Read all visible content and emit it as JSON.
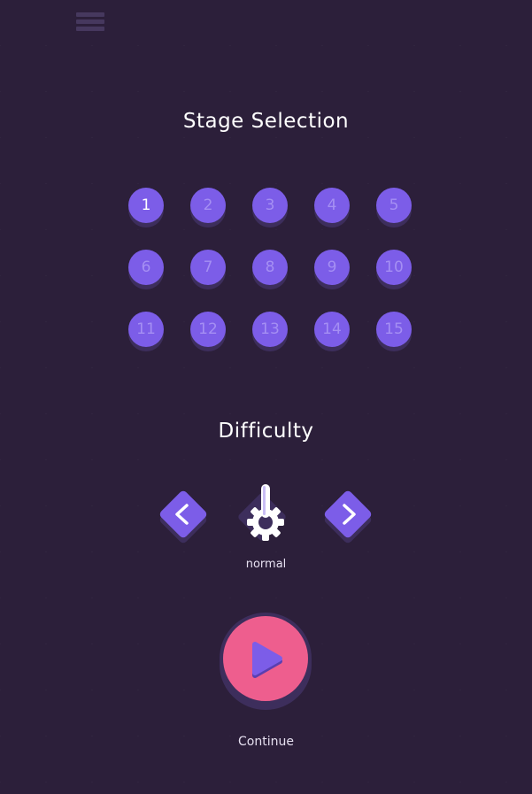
{
  "menu": {
    "icon": "hamburger-menu-icon"
  },
  "stage_selection": {
    "title": "Stage Selection",
    "active_stage": 1,
    "stages": [
      "1",
      "2",
      "3",
      "4",
      "5",
      "6",
      "7",
      "8",
      "9",
      "10",
      "11",
      "12",
      "13",
      "14",
      "15"
    ]
  },
  "difficulty": {
    "title": "Difficulty",
    "value": "normal",
    "prev_icon": "chevron-left-icon",
    "next_icon": "chevron-right-icon",
    "level_icon": "lever-gear-icon"
  },
  "play": {
    "label": "Continue",
    "icon": "play-icon"
  },
  "colors": {
    "background": "#2c1f3a",
    "button": "#7c5de8",
    "button_shadow": "#3d2e5c",
    "play": "#ee5e8e"
  }
}
